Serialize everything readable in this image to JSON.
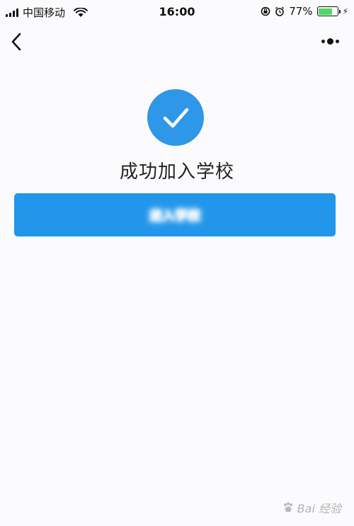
{
  "status_bar": {
    "carrier": "中国移动",
    "time": "16:00",
    "battery_percent": "77%",
    "battery_level": 0.77,
    "icons": [
      "signal-icon",
      "wifi-icon",
      "rotation-lock-icon",
      "alarm-icon",
      "battery-icon",
      "charging-icon"
    ]
  },
  "nav": {
    "back_icon": "chevron-left-icon",
    "more_icon": "more-dots-icon"
  },
  "main": {
    "status_icon": "check-circle-icon",
    "success_text": "成功加入学校",
    "primary_button_label": "进入学校"
  },
  "watermark": {
    "text": "Bai 经验"
  },
  "colors": {
    "accent": "#2196ea",
    "check_circle": "#2f97e8",
    "battery_green": "#4cd964"
  }
}
